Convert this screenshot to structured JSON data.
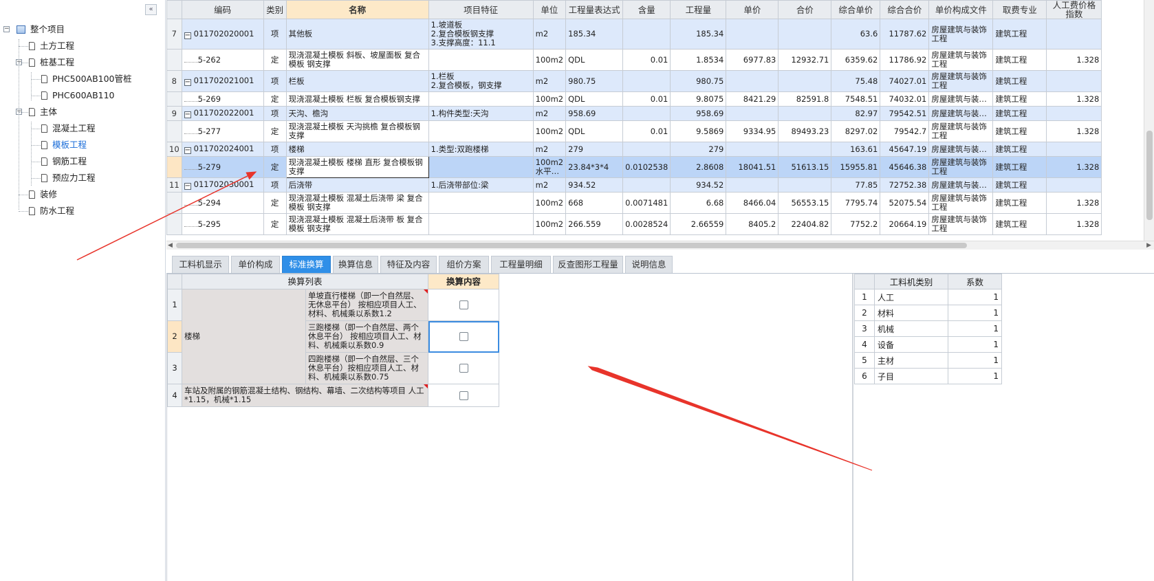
{
  "sidebar": {
    "collapse_label": "«",
    "tree": [
      {
        "label": "整个项目",
        "level": 0,
        "expander": "−",
        "icon": "root"
      },
      {
        "label": "土方工程",
        "level": 1,
        "expander": "",
        "icon": "doc"
      },
      {
        "label": "桩基工程",
        "level": 1,
        "expander": "−",
        "icon": "doc"
      },
      {
        "label": "PHC500AB100管桩",
        "level": 2,
        "expander": "",
        "icon": "doc"
      },
      {
        "label": "PHC600AB110",
        "level": 2,
        "expander": "",
        "icon": "doc"
      },
      {
        "label": "主体",
        "level": 1,
        "expander": "−",
        "icon": "doc"
      },
      {
        "label": "混凝土工程",
        "level": 2,
        "expander": "",
        "icon": "doc"
      },
      {
        "label": "模板工程",
        "level": 2,
        "expander": "",
        "icon": "doc",
        "selected": true
      },
      {
        "label": "钢筋工程",
        "level": 2,
        "expander": "",
        "icon": "doc"
      },
      {
        "label": "预应力工程",
        "level": 2,
        "expander": "",
        "icon": "doc"
      },
      {
        "label": "装修",
        "level": 1,
        "expander": "",
        "icon": "doc"
      },
      {
        "label": "防水工程",
        "level": 1,
        "expander": "",
        "icon": "doc"
      }
    ]
  },
  "grid": {
    "headers": [
      "",
      "编码",
      "类别",
      "名称",
      "项目特征",
      "单位",
      "工程量表达式",
      "含量",
      "工程量",
      "单价",
      "合价",
      "综合单价",
      "综合合价",
      "单价构成文件",
      "取费专业",
      "人工费价格指数"
    ],
    "rows": [
      {
        "type": "q",
        "rn": "7",
        "code": "011702020001",
        "cat": "项",
        "name": "其他板",
        "feature": "1.坡道板\n2.复合模板钢支撑\n3.支撑高度：11.1",
        "unit": "m2",
        "expr": "185.34",
        "content": "",
        "qty": "185.34",
        "price": "",
        "total": "",
        "cprice": "63.6",
        "ctotal": "11787.62",
        "file": "房屋建筑与装饰工程",
        "major": "建筑工程",
        "idx": "",
        "h": 44
      },
      {
        "type": "d",
        "rn": "",
        "code": "5-262",
        "cat": "定",
        "name": "现浇混凝土模板 斜板、坡屋面板 复合模板 钢支撑",
        "feature": "",
        "unit": "100m2",
        "expr": "QDL",
        "content": "0.01",
        "qty": "1.8534",
        "price": "6977.83",
        "total": "12932.71",
        "cprice": "6359.62",
        "ctotal": "11786.92",
        "file": "房屋建筑与装饰工程",
        "major": "建筑工程",
        "idx": "1.328",
        "h": 31
      },
      {
        "type": "q",
        "rn": "8",
        "code": "011702021001",
        "cat": "项",
        "name": "栏板",
        "feature": "1.栏板\n2.复合模板，钢支撑",
        "unit": "m2",
        "expr": "980.75",
        "content": "",
        "qty": "980.75",
        "price": "",
        "total": "",
        "cprice": "75.48",
        "ctotal": "74027.01",
        "file": "房屋建筑与装饰工程",
        "major": "建筑工程",
        "idx": "",
        "h": 31
      },
      {
        "type": "d",
        "rn": "",
        "code": "5-269",
        "cat": "定",
        "name": "现浇混凝土模板 栏板 复合模板钢支撑",
        "feature": "",
        "unit": "100m2",
        "expr": "QDL",
        "content": "0.01",
        "qty": "9.8075",
        "price": "8421.29",
        "total": "82591.8",
        "cprice": "7548.51",
        "ctotal": "74032.01",
        "file": "房屋建筑与装…",
        "major": "建筑工程",
        "idx": "1.328",
        "h": 21
      },
      {
        "type": "q",
        "rn": "9",
        "code": "011702022001",
        "cat": "项",
        "name": "天沟、檐沟",
        "feature": "1.构件类型:天沟",
        "unit": "m2",
        "expr": "958.69",
        "content": "",
        "qty": "958.69",
        "price": "",
        "total": "",
        "cprice": "82.97",
        "ctotal": "79542.51",
        "file": "房屋建筑与装…",
        "major": "建筑工程",
        "idx": "",
        "h": 21
      },
      {
        "type": "d",
        "rn": "",
        "code": "5-277",
        "cat": "定",
        "name": "现浇混凝土模板 天沟挑檐 复合模板钢支撑",
        "feature": "",
        "unit": "100m2",
        "expr": "QDL",
        "content": "0.01",
        "qty": "9.5869",
        "price": "9334.95",
        "total": "89493.23",
        "cprice": "8297.02",
        "ctotal": "79542.7",
        "file": "房屋建筑与装饰工程",
        "major": "建筑工程",
        "idx": "1.328",
        "h": 31
      },
      {
        "type": "q",
        "rn": "10",
        "code": "011702024001",
        "cat": "项",
        "name": "楼梯",
        "feature": "1.类型:双跑楼梯",
        "unit": "m2",
        "expr": "279",
        "content": "",
        "qty": "279",
        "price": "",
        "total": "",
        "cprice": "163.61",
        "ctotal": "45647.19",
        "file": "房屋建筑与装…",
        "major": "建筑工程",
        "idx": "",
        "h": 21
      },
      {
        "type": "sel",
        "rn": "",
        "code": "5-279",
        "cat": "定",
        "name": "现浇混凝土模板 楼梯 直形 复合模板钢支撑",
        "feature": "",
        "unit": "100m2水平…",
        "expr": "23.84*3*4",
        "content": "0.0102538",
        "qty": "2.8608",
        "price": "18041.51",
        "total": "51613.15",
        "cprice": "15955.81",
        "ctotal": "45646.38",
        "file": "房屋建筑与装饰工程",
        "major": "建筑工程",
        "idx": "1.328",
        "h": 31
      },
      {
        "type": "q",
        "rn": "11",
        "code": "011702030001",
        "cat": "项",
        "name": "后浇带",
        "feature": "1.后浇带部位:梁",
        "unit": "m2",
        "expr": "934.52",
        "content": "",
        "qty": "934.52",
        "price": "",
        "total": "",
        "cprice": "77.85",
        "ctotal": "72752.38",
        "file": "房屋建筑与装…",
        "major": "建筑工程",
        "idx": "",
        "h": 21
      },
      {
        "type": "d",
        "rn": "",
        "code": "5-294",
        "cat": "定",
        "name": "现浇混凝土模板 混凝土后浇带 梁 复合模板 钢支撑",
        "feature": "",
        "unit": "100m2",
        "expr": "668",
        "content": "0.0071481",
        "qty": "6.68",
        "price": "8466.04",
        "total": "56553.15",
        "cprice": "7795.74",
        "ctotal": "52075.54",
        "file": "房屋建筑与装饰工程",
        "major": "建筑工程",
        "idx": "1.328",
        "h": 31
      },
      {
        "type": "d",
        "rn": "",
        "code": "5-295",
        "cat": "定",
        "name": "现浇混凝土模板 混凝土后浇带 板 复合模板 钢支撑",
        "feature": "",
        "unit": "100m2",
        "expr": "266.559",
        "content": "0.0028524",
        "qty": "2.66559",
        "price": "8405.2",
        "total": "22404.82",
        "cprice": "7752.2",
        "ctotal": "20664.19",
        "file": "房屋建筑与装饰工程",
        "major": "建筑工程",
        "idx": "1.328",
        "h": 31
      }
    ]
  },
  "tabs": [
    {
      "label": "工料机显示",
      "active": false
    },
    {
      "label": "单价构成",
      "active": false
    },
    {
      "label": "标准换算",
      "active": true
    },
    {
      "label": "换算信息",
      "active": false
    },
    {
      "label": "特征及内容",
      "active": false
    },
    {
      "label": "组价方案",
      "active": false
    },
    {
      "label": "工程量明细",
      "active": false
    },
    {
      "label": "反查图形工程量",
      "active": false
    },
    {
      "label": "说明信息",
      "active": false
    }
  ],
  "conversion": {
    "header_list": "换算列表",
    "header_content": "换算内容",
    "group_label": "楼梯",
    "items": [
      {
        "rn": "1",
        "text": "单坡直行楼梯（即一个自然层、无休息平台） 按相应项目人工、材料、机械乘以系数1.2"
      },
      {
        "rn": "2",
        "text": "三跑楼梯（即一个自然层、两个休息平台） 按相应项目人工、材料、机械乘以系数0.9"
      },
      {
        "rn": "3",
        "text": "四跑楼梯（即一个自然层、三个休息平台）按相应项目人工、材料、机械乘以系数0.75"
      }
    ],
    "row4": {
      "rn": "4",
      "text": "车站及附属的钢筋混凝土结构、钢结构、幕墙、二次结构等项目 人工*1.15，机械*1.15"
    }
  },
  "factor_table": {
    "header_type": "工料机类别",
    "header_coef": "系数",
    "rows": [
      {
        "rn": "1",
        "type": "人工",
        "coef": "1"
      },
      {
        "rn": "2",
        "type": "材料",
        "coef": "1"
      },
      {
        "rn": "3",
        "type": "机械",
        "coef": "1"
      },
      {
        "rn": "4",
        "type": "设备",
        "coef": "1"
      },
      {
        "rn": "5",
        "type": "主材",
        "coef": "1"
      },
      {
        "rn": "6",
        "type": "子目",
        "coef": "1"
      }
    ]
  },
  "colors": {
    "accent": "#2f8fe8",
    "selected_row": "#bcd5f7",
    "item_row": "#dde9fb",
    "arrow": "#e8342b"
  }
}
